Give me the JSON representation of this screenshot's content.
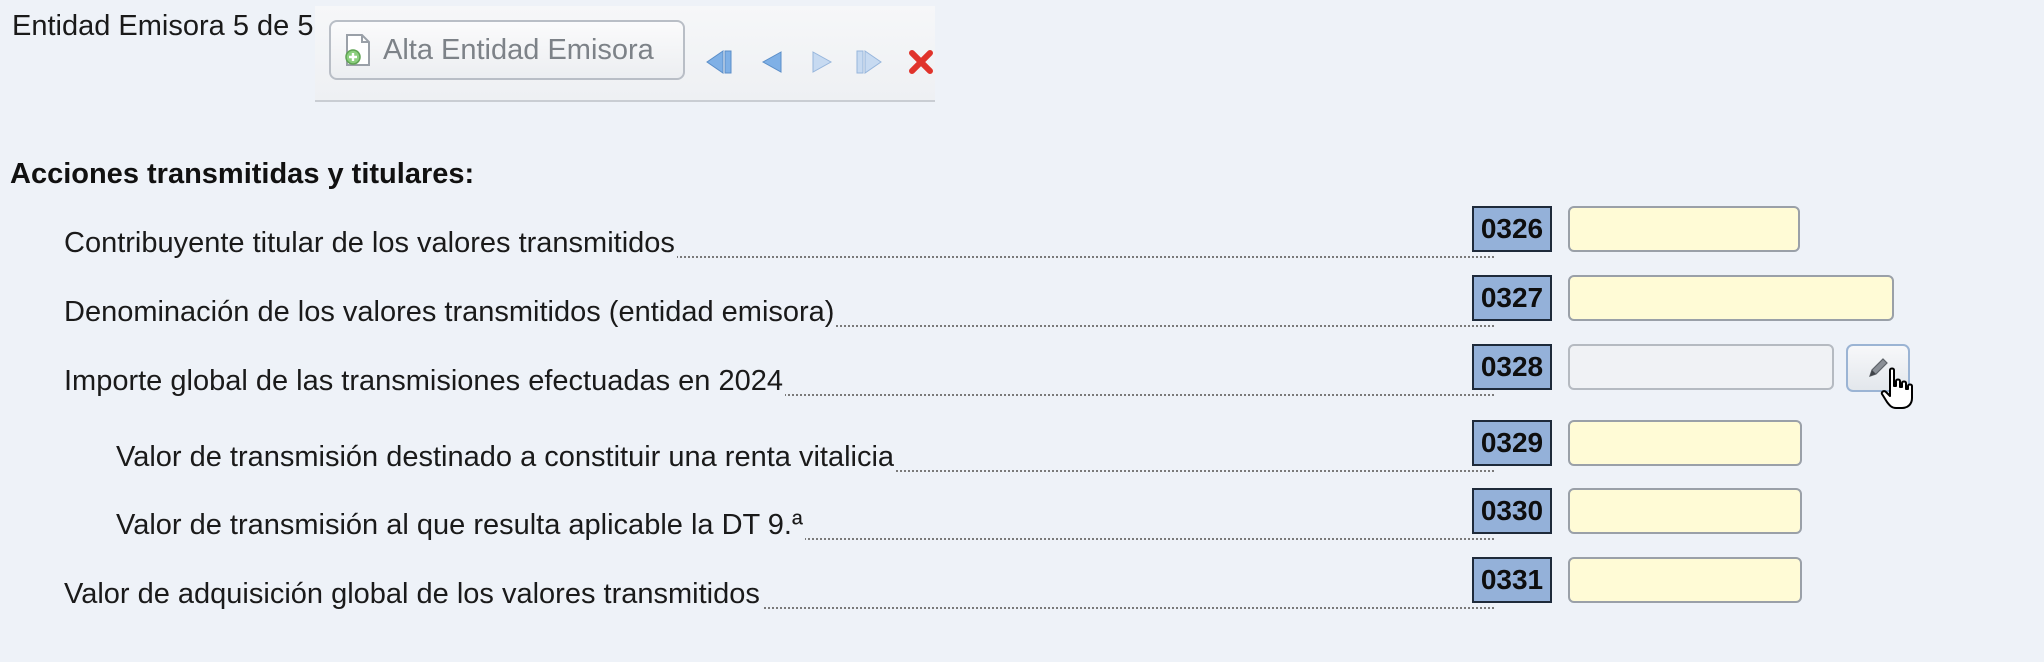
{
  "header": {
    "entity_counter": "Entidad Emisora 5 de 5",
    "add_button_label": "Alta Entidad Emisora"
  },
  "toolbar": {
    "icons": [
      "add-document-icon",
      "first-record-icon",
      "previous-record-icon",
      "next-record-icon",
      "last-record-icon",
      "delete-icon"
    ]
  },
  "section": {
    "title": "Acciones transmitidas y titulares:"
  },
  "rows": [
    {
      "label": "Contribuyente titular de los valores transmitidos",
      "code": "0326",
      "value": ""
    },
    {
      "label": "Denominación de los valores transmitidos (entidad emisora)",
      "code": "0327",
      "value": ""
    },
    {
      "label": "Importe global de las transmisiones efectuadas en 2024",
      "code": "0328",
      "value": ""
    },
    {
      "label": "Valor de transmisión destinado a constituir una renta vitalicia",
      "code": "0329",
      "value": ""
    },
    {
      "label": "Valor de transmisión al que resulta aplicable la DT 9.ª",
      "code": "0330",
      "value": ""
    },
    {
      "label": "Valor de adquisición global de los valores transmitidos",
      "code": "0331",
      "value": ""
    }
  ],
  "colors": {
    "background": "#eef2f8",
    "code_box": "#94b1d9",
    "input_fill": "#fffbd6",
    "nav_arrow": "#7fb0e6",
    "delete_red": "#e0332b"
  }
}
